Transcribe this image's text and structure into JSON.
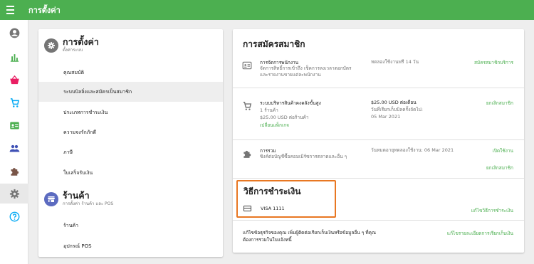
{
  "topbar": {
    "title": "การตั้งค่า"
  },
  "rail": {
    "items": [
      {
        "icon": "account-circle-icon",
        "color": "#757575"
      },
      {
        "icon": "bar-chart-icon",
        "color": "#4caf50"
      },
      {
        "icon": "basket-icon",
        "color": "#e91e63"
      },
      {
        "icon": "cart-icon",
        "color": "#03a9f4"
      },
      {
        "icon": "badge-icon",
        "color": "#4caf50"
      },
      {
        "icon": "people-icon",
        "color": "#3f51b5"
      },
      {
        "icon": "puzzle-icon",
        "color": "#795548"
      },
      {
        "icon": "gear-icon",
        "color": "#757575",
        "active": true
      },
      {
        "icon": "help-icon",
        "color": "#03a9f4"
      }
    ]
  },
  "settings": {
    "title": "การตั้งค่า",
    "subtitle": "ตั้งค่าระบบ",
    "items": [
      {
        "label": "คุณสมบัติ"
      },
      {
        "label": "ระบบบิลลิ่งและสมัครเป็นสมาชิก",
        "selected": true
      },
      {
        "label": "ประเภทการชำระเงิน"
      },
      {
        "label": "ความจงรักภักดี"
      },
      {
        "label": "ภาษี"
      },
      {
        "label": "ใบเสร็จรับเงิน"
      }
    ]
  },
  "store": {
    "title": "ร้านค้า",
    "subtitle": "การตั้งค่า ร้านค้า และ POS",
    "items": [
      {
        "label": "ร้านค้า"
      },
      {
        "label": "อุปกรณ์ POS"
      }
    ]
  },
  "subscription": {
    "title": "การสมัครสมาชิก",
    "rows": [
      {
        "name": "การจัดการพนักงาน",
        "desc": "จัดการสิทธิ์การเข้าถึง เช็คการลงเวลาตอกบัตร และรายงานขายแต่ละพนักงาน",
        "status": "ทดลองใช้งานฟรี 14 วัน",
        "action": "สมัครสมาชิกบริการ"
      },
      {
        "name": "ระบบบริหารสินค้าคงคลังขั้นสูง",
        "desc1": "1 ร้านค้า",
        "desc2": "$25.00 USD ต่อร้านค้า",
        "link": "เปลี่ยนแพ็กเกจ",
        "price": "$25.00 USD ต่อเดือน",
        "next_billing_label": "วันที่เรียกเก็บบิลครั้งถัดไป:",
        "next_billing_date": "05 Mar 2021",
        "action": "ยกเลิกสมาชิก"
      },
      {
        "name": "การรวม",
        "desc": "ซิงค์ต่อบัญชีซื้อคอมเมิร์ซการตลาดและอื่น ๆ",
        "status": "วันหมดอายุทดลองใช้งาน: 06 Mar 2021",
        "action1": "เปิดใช้งาน",
        "action2": "ยกเลิกสมาชิก"
      }
    ]
  },
  "payment": {
    "title": "วิธีการชำระเงิน",
    "card": "VISA 1111",
    "action": "แก้ไขวิธีการชำระเงิน",
    "highlight_color": "#e87722"
  },
  "billing": {
    "text": "แก้ไขข้อธุรกิจของคุณ เพิ่มผู้ติดต่อเรียกเก็บเงินหรือข้อมูลอื่น ๆ ที่คุณต้องการรวมในใบแจ้งหนี้",
    "action": "แก้ไขรายละเอียดการเรียกเก็บเงิน"
  },
  "colors": {
    "brand": "#4caf50",
    "accent": "#4caf50"
  }
}
